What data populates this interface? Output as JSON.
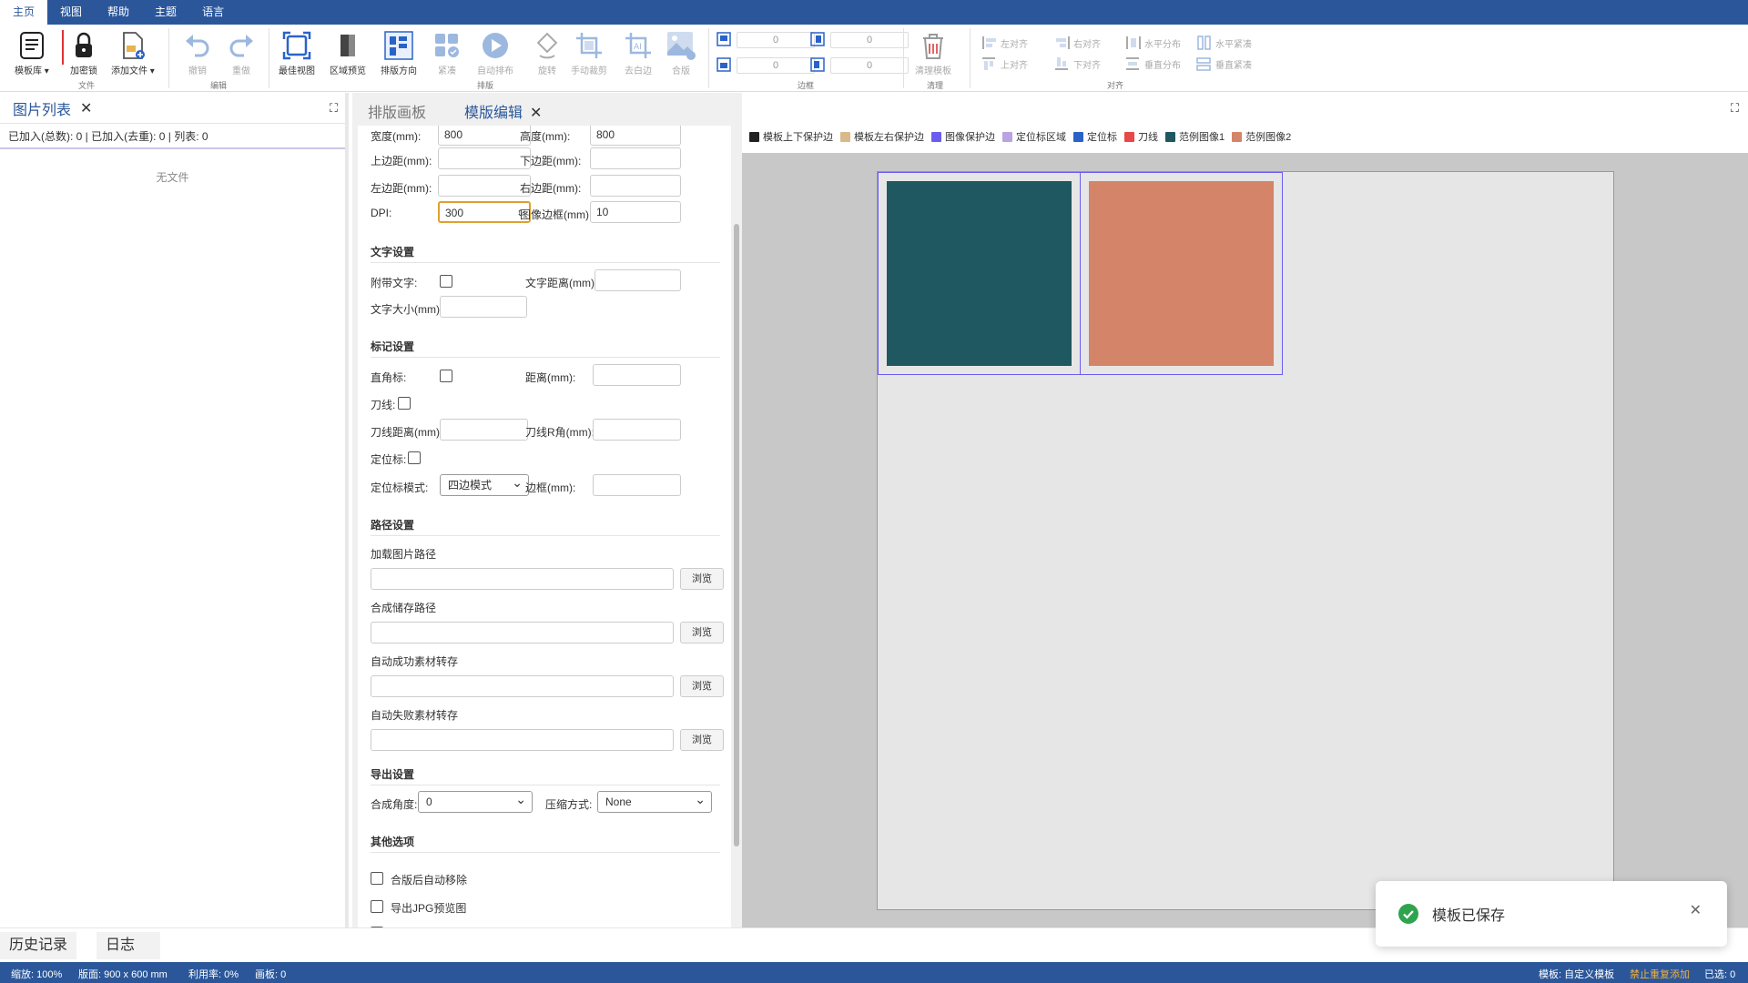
{
  "menu": {
    "tabs": [
      "主页",
      "视图",
      "帮助",
      "主题",
      "语言"
    ]
  },
  "ribbon": {
    "file": {
      "template_lib": "模板库",
      "encrypt": "加密锁",
      "add_file": "添加文件",
      "group": "文件"
    },
    "edit": {
      "undo": "撤销",
      "redo": "重做",
      "group": "编辑"
    },
    "layout": {
      "best_view": "最佳视图",
      "area_preview": "区域预览",
      "direction": "排版方向",
      "compact": "紧凑",
      "auto_layout": "自动排布",
      "rotate": "旋转",
      "manual_crop": "手动裁剪",
      "remove_white": "去白边",
      "merge": "合版",
      "group": "排版"
    },
    "margin": {
      "values": [
        "0",
        "0",
        "0",
        "0"
      ],
      "group": "边框"
    },
    "clean": {
      "clean_template": "清理模板",
      "group": "清理"
    },
    "align": {
      "left": "左对齐",
      "right": "右对齐",
      "h_dist": "水平分布",
      "h_compact": "水平紧凑",
      "top": "上对齐",
      "bottom": "下对齐",
      "v_dist": "垂直分布",
      "v_compact": "垂直紧凑",
      "group": "对齐"
    }
  },
  "left_panel": {
    "tab": "图片列表",
    "stats": "已加入(总数): 0 | 已加入(去重): 0 | 列表: 0",
    "empty": "无文件"
  },
  "center_tabs": {
    "layout_canvas": "排版画板",
    "template_edit": "模版编辑"
  },
  "form": {
    "width_label": "宽度(mm):",
    "width": "800",
    "height_label": "高度(mm):",
    "height": "800",
    "top_margin": "上边距(mm):",
    "bottom_margin": "下边距(mm):",
    "left_margin": "左边距(mm):",
    "right_margin": "右边距(mm):",
    "dpi_label": "DPI:",
    "dpi": "300",
    "img_border_label": "图像边框(mm):",
    "img_border": "10",
    "text_section": "文字设置",
    "attach_text": "附带文字:",
    "text_distance": "文字距离(mm):",
    "text_size": "文字大小(mm):",
    "mark_section": "标记设置",
    "corner_mark": "直角标:",
    "distance": "距离(mm):",
    "cut_line": "刀线:",
    "cut_distance": "刀线距离(mm):",
    "cut_radius": "刀线R角(mm):",
    "locator": "定位标:",
    "locator_mode_label": "定位标模式:",
    "locator_mode": "四边模式",
    "border": "边框(mm):",
    "path_section": "路径设置",
    "load_path": "加载图片路径",
    "save_path": "合成储存路径",
    "success_path": "自动成功素材转存",
    "fail_path": "自动失败素材转存",
    "browse": "浏览",
    "export_section": "导出设置",
    "angle_label": "合成角度:",
    "angle": "0",
    "compress_label": "压缩方式:",
    "compress": "None",
    "other_section": "其他选项",
    "auto_remove": "合版后自动移除",
    "export_jpg": "导出JPG预览图"
  },
  "legend": [
    {
      "label": "模板上下保护边",
      "color": "#222222"
    },
    {
      "label": "模板左右保护边",
      "color": "#d9b98a"
    },
    {
      "label": "图像保护边",
      "color": "#6b5cf0"
    },
    {
      "label": "定位标区域",
      "color": "#b8a4e0"
    },
    {
      "label": "定位标",
      "color": "#2a63c8"
    },
    {
      "label": "刀线",
      "color": "#e84848"
    },
    {
      "label": "范例图像1",
      "color": "#1f5861"
    },
    {
      "label": "范例图像2",
      "color": "#d48468"
    }
  ],
  "bottom_tabs": {
    "history": "历史记录",
    "log": "日志"
  },
  "status": {
    "zoom": "缩放: 100%",
    "board": "版面: 900 x 600 mm",
    "usage": "利用率: 0%",
    "canvas": "画板: 0",
    "template": "模板: 自定义模板",
    "no_dup": "禁止重复添加",
    "selected": "已选: 0"
  },
  "toast": {
    "message": "模板已保存"
  }
}
